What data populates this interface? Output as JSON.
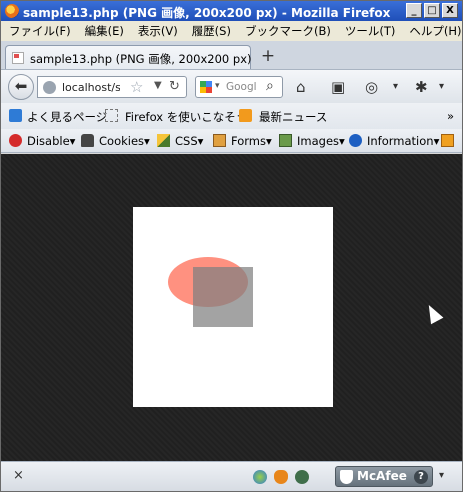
{
  "window": {
    "title": "sample13.php (PNG 画像, 200x200 px) - Mozilla Firefox",
    "controls": {
      "minimize": "_",
      "maximize": "□",
      "close": "X"
    }
  },
  "menu": [
    "ファイル(F)",
    "編集(E)",
    "表示(V)",
    "履歴(S)",
    "ブックマーク(B)",
    "ツール(T)",
    "ヘルプ(H)"
  ],
  "tab": {
    "label": "sample13.php (PNG 画像, 200x200 px)",
    "new_tab": "+"
  },
  "nav": {
    "url": "localhost/s",
    "search_engine_icon": "google-icon",
    "search_value": "Googl"
  },
  "bookmarks": [
    "よく見るページ",
    "Firefox を使いこなそう",
    "最新ニュース"
  ],
  "bookmarks_overflow": "»",
  "devtools": [
    "Disable▾",
    "Cookies▾",
    "CSS▾",
    "Forms▾",
    "Images▾",
    "Information▾"
  ],
  "addon": {
    "close": "×",
    "mcafee": "McAfee",
    "help": "?",
    "dropdown": "▾"
  },
  "image_content": {
    "ellipse_color": "#ff9180",
    "square_color": "#808080"
  }
}
